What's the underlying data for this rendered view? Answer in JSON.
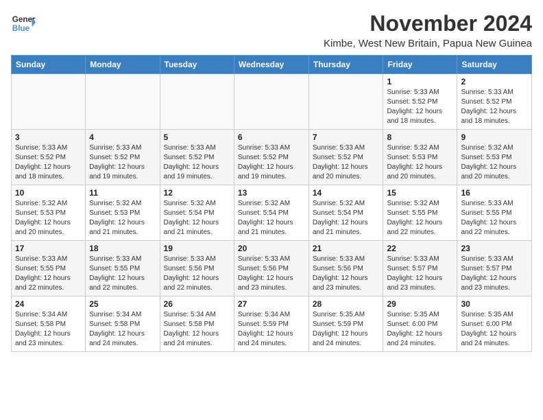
{
  "logo": {
    "line1": "General",
    "line2": "Blue"
  },
  "title": "November 2024",
  "location": "Kimbe, West New Britain, Papua New Guinea",
  "days_of_week": [
    "Sunday",
    "Monday",
    "Tuesday",
    "Wednesday",
    "Thursday",
    "Friday",
    "Saturday"
  ],
  "weeks": [
    [
      {
        "day": "",
        "info": ""
      },
      {
        "day": "",
        "info": ""
      },
      {
        "day": "",
        "info": ""
      },
      {
        "day": "",
        "info": ""
      },
      {
        "day": "",
        "info": ""
      },
      {
        "day": "1",
        "info": "Sunrise: 5:33 AM\nSunset: 5:52 PM\nDaylight: 12 hours\nand 18 minutes."
      },
      {
        "day": "2",
        "info": "Sunrise: 5:33 AM\nSunset: 5:52 PM\nDaylight: 12 hours\nand 18 minutes."
      }
    ],
    [
      {
        "day": "3",
        "info": "Sunrise: 5:33 AM\nSunset: 5:52 PM\nDaylight: 12 hours\nand 18 minutes."
      },
      {
        "day": "4",
        "info": "Sunrise: 5:33 AM\nSunset: 5:52 PM\nDaylight: 12 hours\nand 19 minutes."
      },
      {
        "day": "5",
        "info": "Sunrise: 5:33 AM\nSunset: 5:52 PM\nDaylight: 12 hours\nand 19 minutes."
      },
      {
        "day": "6",
        "info": "Sunrise: 5:33 AM\nSunset: 5:52 PM\nDaylight: 12 hours\nand 19 minutes."
      },
      {
        "day": "7",
        "info": "Sunrise: 5:33 AM\nSunset: 5:52 PM\nDaylight: 12 hours\nand 20 minutes."
      },
      {
        "day": "8",
        "info": "Sunrise: 5:32 AM\nSunset: 5:53 PM\nDaylight: 12 hours\nand 20 minutes."
      },
      {
        "day": "9",
        "info": "Sunrise: 5:32 AM\nSunset: 5:53 PM\nDaylight: 12 hours\nand 20 minutes."
      }
    ],
    [
      {
        "day": "10",
        "info": "Sunrise: 5:32 AM\nSunset: 5:53 PM\nDaylight: 12 hours\nand 20 minutes."
      },
      {
        "day": "11",
        "info": "Sunrise: 5:32 AM\nSunset: 5:53 PM\nDaylight: 12 hours\nand 21 minutes."
      },
      {
        "day": "12",
        "info": "Sunrise: 5:32 AM\nSunset: 5:54 PM\nDaylight: 12 hours\nand 21 minutes."
      },
      {
        "day": "13",
        "info": "Sunrise: 5:32 AM\nSunset: 5:54 PM\nDaylight: 12 hours\nand 21 minutes."
      },
      {
        "day": "14",
        "info": "Sunrise: 5:32 AM\nSunset: 5:54 PM\nDaylight: 12 hours\nand 21 minutes."
      },
      {
        "day": "15",
        "info": "Sunrise: 5:32 AM\nSunset: 5:55 PM\nDaylight: 12 hours\nand 22 minutes."
      },
      {
        "day": "16",
        "info": "Sunrise: 5:33 AM\nSunset: 5:55 PM\nDaylight: 12 hours\nand 22 minutes."
      }
    ],
    [
      {
        "day": "17",
        "info": "Sunrise: 5:33 AM\nSunset: 5:55 PM\nDaylight: 12 hours\nand 22 minutes."
      },
      {
        "day": "18",
        "info": "Sunrise: 5:33 AM\nSunset: 5:55 PM\nDaylight: 12 hours\nand 22 minutes."
      },
      {
        "day": "19",
        "info": "Sunrise: 5:33 AM\nSunset: 5:56 PM\nDaylight: 12 hours\nand 22 minutes."
      },
      {
        "day": "20",
        "info": "Sunrise: 5:33 AM\nSunset: 5:56 PM\nDaylight: 12 hours\nand 23 minutes."
      },
      {
        "day": "21",
        "info": "Sunrise: 5:33 AM\nSunset: 5:56 PM\nDaylight: 12 hours\nand 23 minutes."
      },
      {
        "day": "22",
        "info": "Sunrise: 5:33 AM\nSunset: 5:57 PM\nDaylight: 12 hours\nand 23 minutes."
      },
      {
        "day": "23",
        "info": "Sunrise: 5:33 AM\nSunset: 5:57 PM\nDaylight: 12 hours\nand 23 minutes."
      }
    ],
    [
      {
        "day": "24",
        "info": "Sunrise: 5:34 AM\nSunset: 5:58 PM\nDaylight: 12 hours\nand 23 minutes."
      },
      {
        "day": "25",
        "info": "Sunrise: 5:34 AM\nSunset: 5:58 PM\nDaylight: 12 hours\nand 24 minutes."
      },
      {
        "day": "26",
        "info": "Sunrise: 5:34 AM\nSunset: 5:58 PM\nDaylight: 12 hours\nand 24 minutes."
      },
      {
        "day": "27",
        "info": "Sunrise: 5:34 AM\nSunset: 5:59 PM\nDaylight: 12 hours\nand 24 minutes."
      },
      {
        "day": "28",
        "info": "Sunrise: 5:35 AM\nSunset: 5:59 PM\nDaylight: 12 hours\nand 24 minutes."
      },
      {
        "day": "29",
        "info": "Sunrise: 5:35 AM\nSunset: 6:00 PM\nDaylight: 12 hours\nand 24 minutes."
      },
      {
        "day": "30",
        "info": "Sunrise: 5:35 AM\nSunset: 6:00 PM\nDaylight: 12 hours\nand 24 minutes."
      }
    ]
  ]
}
